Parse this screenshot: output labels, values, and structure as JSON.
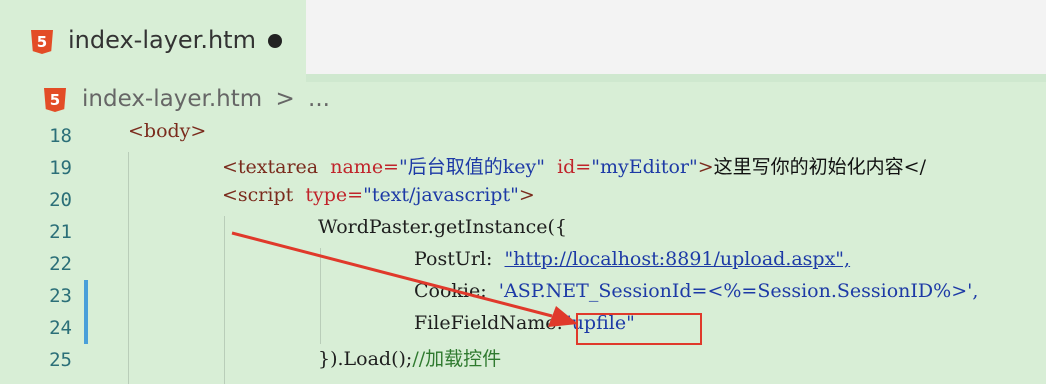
{
  "tab": {
    "file_icon_label": "5",
    "title": "index-layer.htm"
  },
  "breadcrumb": {
    "file_icon_label": "5",
    "file": "index-layer.htm",
    "separator": ">",
    "ellipsis": "..."
  },
  "code": {
    "line_numbers": [
      "18",
      "19",
      "20",
      "21",
      "22",
      "23",
      "24",
      "25"
    ],
    "l18_body": "<body>",
    "l19_open": "<textarea",
    "l19_name_attr": "name=",
    "l19_name_val": "\"后台取值的key\"",
    "l19_id_attr": "id=",
    "l19_id_val": "\"myEditor\"",
    "l19_close": ">",
    "l19_text": "这里写你的初始化内容</",
    "l20_open": "<script",
    "l20_type_attr": "type=",
    "l20_type_val": "\"text/javascript\"",
    "l20_close": ">",
    "l21": "WordPaster.getInstance({",
    "l22_key": "PostUrl:",
    "l22_val": "\"http://localhost:8891/upload.aspx\",",
    "l23_key": "Cookie:",
    "l23_val": "'ASP.NET_SessionId=<%=Session.SessionID%>',",
    "l24_key": "FileFieldName:",
    "l24_val": "\"upfile\"",
    "l25_code": "}).Load();",
    "l25_comment": "//加载控件"
  },
  "colors": {
    "background": "#d8eed6",
    "highlight_box": "#e0392b",
    "arrow": "#e0392b",
    "modified_marker": "#4a9fd9",
    "html5_icon": "#e34c26"
  }
}
